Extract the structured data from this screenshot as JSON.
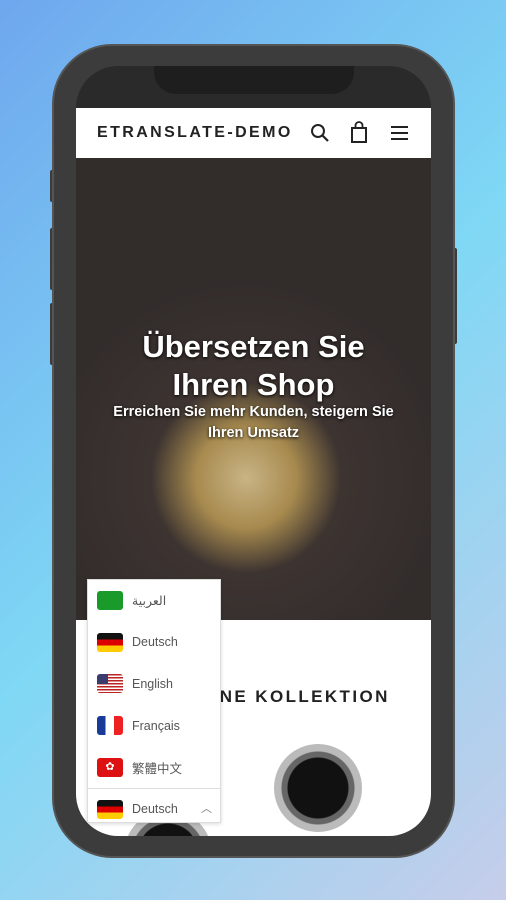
{
  "header": {
    "logo": "ETRANSLATE-DEMO",
    "icons": [
      "search-icon",
      "bag-icon",
      "menu-icon"
    ]
  },
  "hero": {
    "title_line1": "Übersetzen Sie",
    "title_line2": "Ihren Shop",
    "subtitle": "Erreichen Sie mehr Kunden, steigern Sie Ihren Umsatz"
  },
  "collection": {
    "heading_visible": "ENE KOLLEKTION"
  },
  "language_menu": {
    "items": [
      {
        "label": "العربية",
        "flag": "saudi-arabia"
      },
      {
        "label": "Deutsch",
        "flag": "germany"
      },
      {
        "label": "English",
        "flag": "usa"
      },
      {
        "label": "Français",
        "flag": "france"
      },
      {
        "label": "繁體中文",
        "flag": "hong-kong"
      }
    ],
    "selected": "Deutsch"
  }
}
